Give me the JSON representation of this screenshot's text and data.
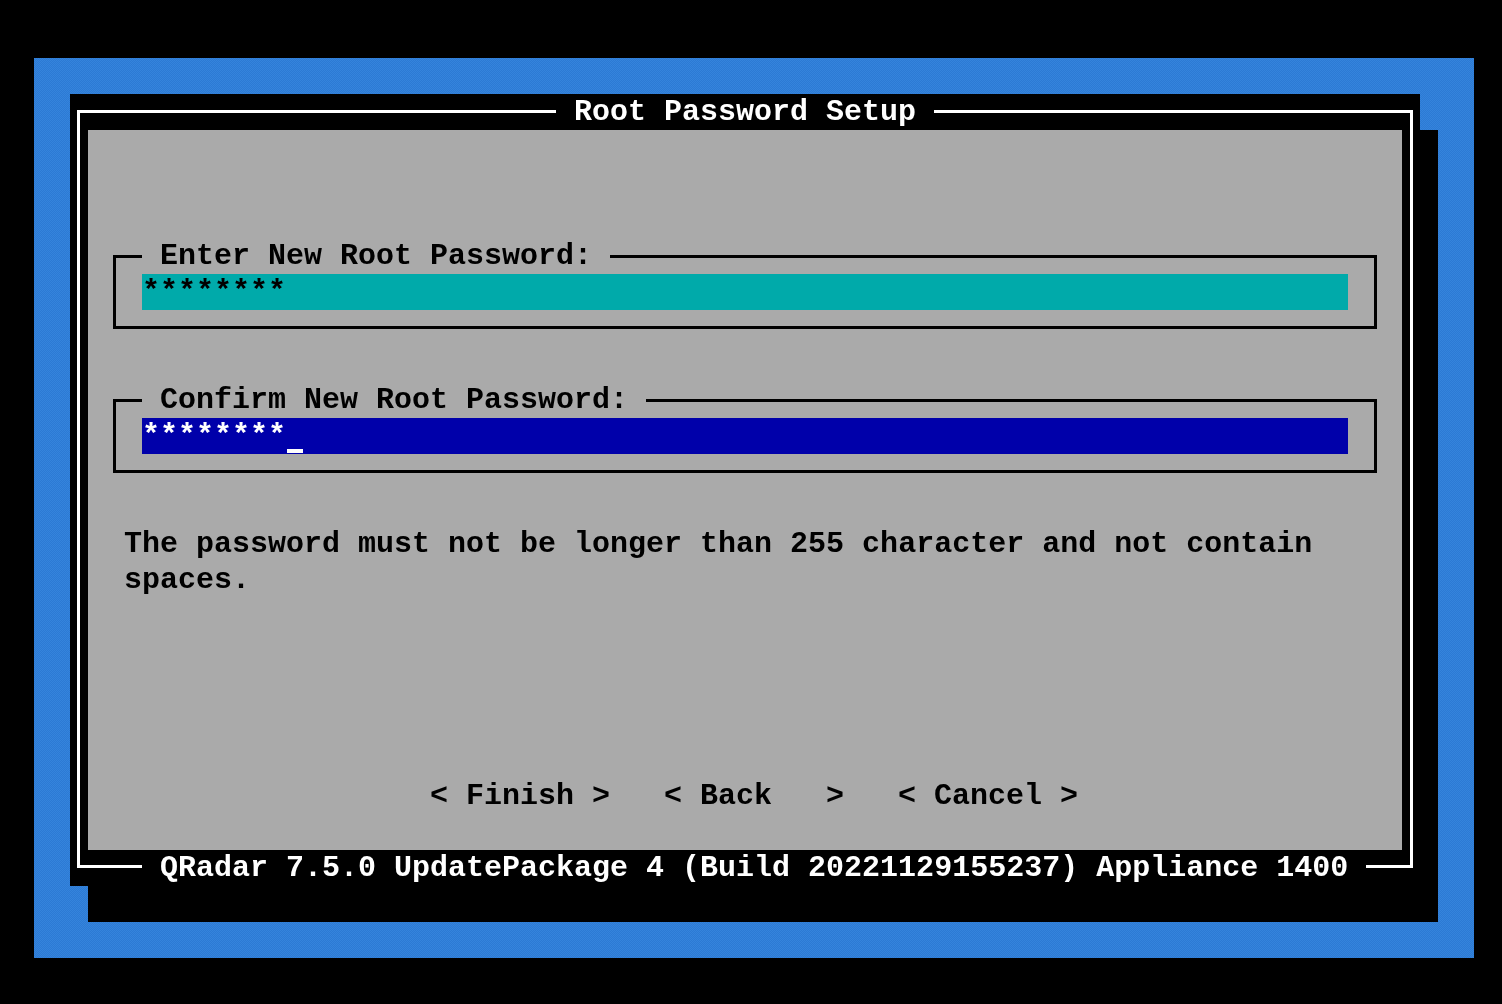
{
  "dialog": {
    "title": "Root Password Setup",
    "fields": [
      {
        "label": "Enter New Root Password:",
        "value": "********",
        "focused": false
      },
      {
        "label": "Confirm New Root Password:",
        "value": "********",
        "focused": true
      }
    ],
    "message": "The password must not be longer than 255 character and not contain spaces.",
    "buttons": [
      {
        "label": "< Finish >"
      },
      {
        "label": "< Back   >"
      },
      {
        "label": "< Cancel >"
      }
    ],
    "footer": "QRadar 7.5.0 UpdatePackage 4 (Build 20221129155237) Appliance 1400"
  }
}
